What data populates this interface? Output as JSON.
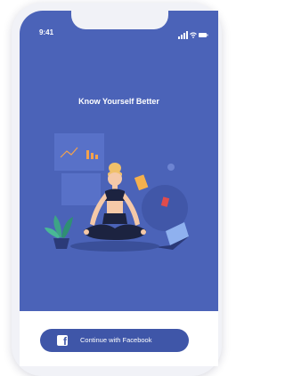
{
  "status_bar": {
    "time": "9:41",
    "icons": [
      "signal-icon",
      "wifi-icon",
      "battery-icon"
    ]
  },
  "onboarding": {
    "title": "Know Yourself Better"
  },
  "auth": {
    "facebook_label": "Continue with Facebook"
  },
  "colors": {
    "hero_background": "#4b63b8",
    "button_background": "#3f56a8",
    "accent_orange": "#f4a24c",
    "accent_red": "#e04c4c"
  }
}
